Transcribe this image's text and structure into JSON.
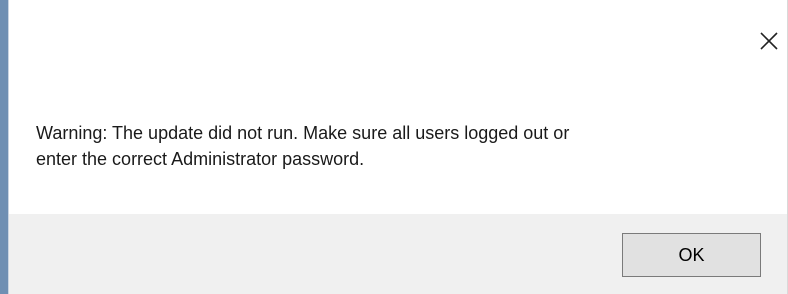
{
  "dialog": {
    "message_line_1": "Warning: The update did not run. Make sure all users logged out or",
    "message_line_2": "enter the correct Administrator password.",
    "ok_label": "OK",
    "close_icon": "close-icon"
  },
  "colors": {
    "background": "#ffffff",
    "footer": "#f0f0f0",
    "button_face": "#e1e1e1",
    "button_border": "#7a7a7a",
    "window_edge": "#6f8fb3"
  }
}
